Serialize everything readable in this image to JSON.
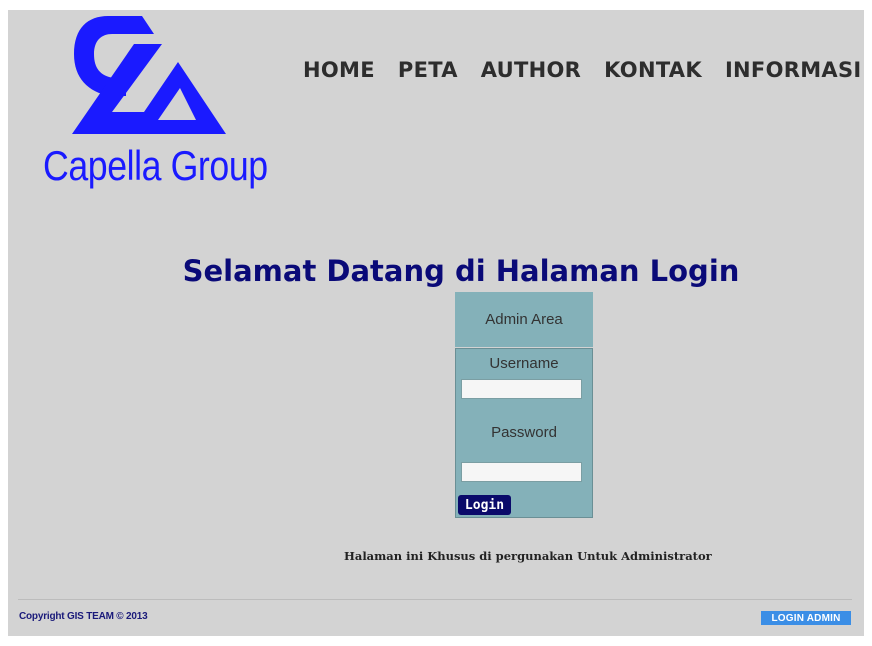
{
  "logo": {
    "text": "Capella Group",
    "color": "#1a1aff"
  },
  "nav": {
    "items": [
      "HOME",
      "PETA",
      "AUTHOR",
      "KONTAK",
      "INFORMASI"
    ]
  },
  "main": {
    "title": "Selamat Datang di Halaman Login"
  },
  "login": {
    "header": "Admin Area",
    "username_label": "Username",
    "password_label": "Password",
    "username_value": "",
    "password_value": "",
    "button_label": "Login"
  },
  "note": "Halaman ini Khusus di pergunakan Untuk Administrator",
  "footer": {
    "copyright": "Copyright GIS TEAM © 2013",
    "admin_link": "LOGIN ADMIN"
  },
  "colors": {
    "background": "#d3d3d3",
    "login_box": "#84b1b9",
    "title": "#0a0a78",
    "button": "#0a0a6a",
    "admin_link": "#3b8ee6"
  }
}
